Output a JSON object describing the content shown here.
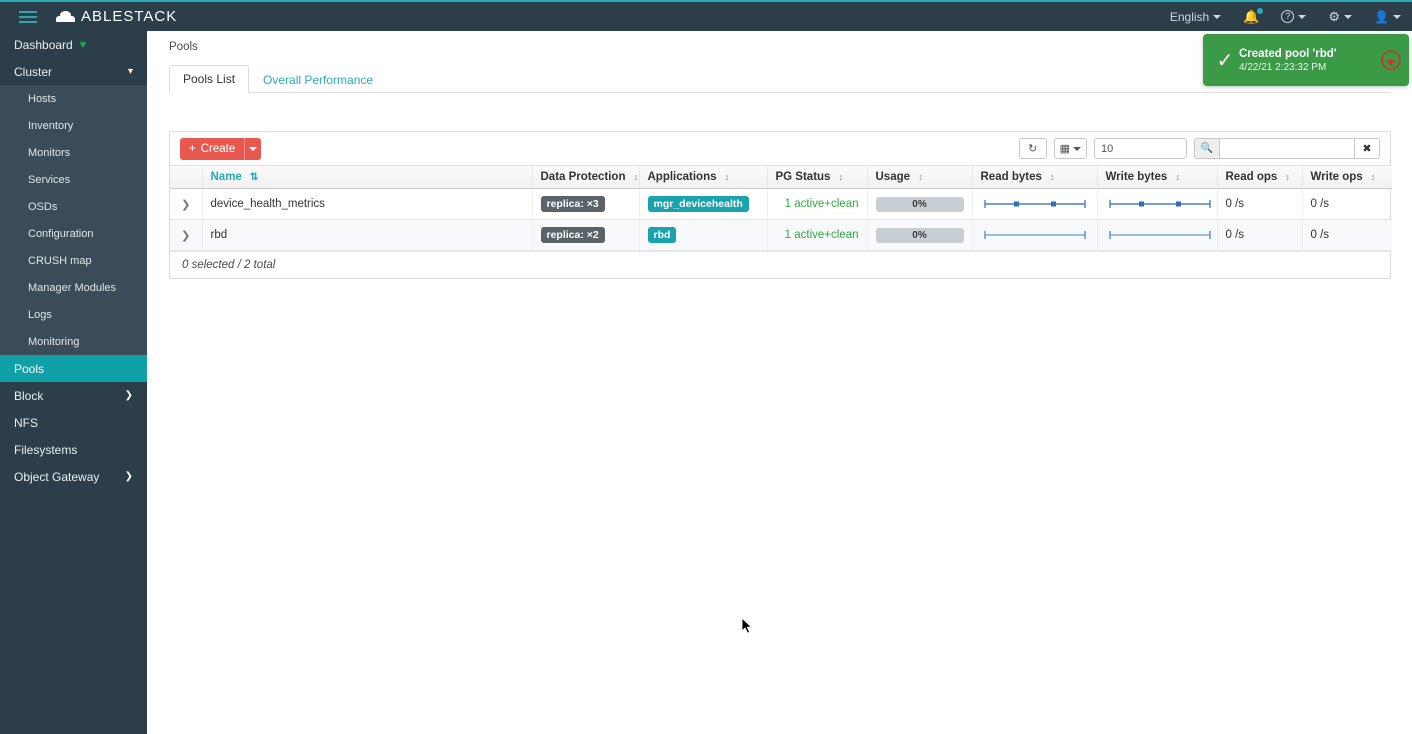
{
  "topbar": {
    "brand": "ABLESTACK",
    "menu_icon": "hamburger-icon",
    "language": "English",
    "items": [
      {
        "name": "notifications",
        "icon": "bell-icon"
      },
      {
        "name": "help",
        "icon": "question-circle-icon"
      },
      {
        "name": "settings",
        "icon": "gear-icon"
      },
      {
        "name": "user",
        "icon": "user-icon"
      }
    ]
  },
  "sidebar": {
    "items": [
      {
        "label": "Dashboard",
        "badge": "heart",
        "level": 0,
        "expandable": false,
        "active": false
      },
      {
        "label": "Cluster",
        "level": 0,
        "expandable": true,
        "expanded": true,
        "active": false
      },
      {
        "label": "Hosts",
        "level": 1,
        "active": false
      },
      {
        "label": "Inventory",
        "level": 1,
        "active": false
      },
      {
        "label": "Monitors",
        "level": 1,
        "active": false
      },
      {
        "label": "Services",
        "level": 1,
        "active": false
      },
      {
        "label": "OSDs",
        "level": 1,
        "active": false
      },
      {
        "label": "Configuration",
        "level": 1,
        "active": false
      },
      {
        "label": "CRUSH map",
        "level": 1,
        "active": false
      },
      {
        "label": "Manager Modules",
        "level": 1,
        "active": false
      },
      {
        "label": "Logs",
        "level": 1,
        "active": false
      },
      {
        "label": "Monitoring",
        "level": 1,
        "active": false
      },
      {
        "label": "Pools",
        "level": 0,
        "expandable": false,
        "active": true
      },
      {
        "label": "Block",
        "level": 0,
        "expandable": true,
        "expanded": false,
        "active": false
      },
      {
        "label": "NFS",
        "level": 0,
        "expandable": false,
        "active": false
      },
      {
        "label": "Filesystems",
        "level": 0,
        "expandable": false,
        "active": false
      },
      {
        "label": "Object Gateway",
        "level": 0,
        "expandable": true,
        "expanded": false,
        "active": false
      }
    ]
  },
  "breadcrumb": "Pools",
  "tabs": [
    {
      "label": "Pools List",
      "active": true
    },
    {
      "label": "Overall Performance",
      "active": false
    }
  ],
  "toolbar": {
    "create_label": "Create",
    "create_plus": "+",
    "refresh_icon": "refresh-icon",
    "columns_icon": "table-columns-icon",
    "limit_value": "10",
    "limit_placeholder": "10",
    "search_value": "",
    "search_placeholder": "",
    "search_icon": "search-icon",
    "clear_icon": "close-icon"
  },
  "table": {
    "columns": [
      {
        "label": "",
        "key": "expand"
      },
      {
        "label": "Name",
        "key": "name",
        "sorted": true
      },
      {
        "label": "Data Protection",
        "key": "data_protection"
      },
      {
        "label": "Applications",
        "key": "applications"
      },
      {
        "label": "PG Status",
        "key": "pg_status"
      },
      {
        "label": "Usage",
        "key": "usage"
      },
      {
        "label": "Read bytes",
        "key": "read_bytes"
      },
      {
        "label": "Write bytes",
        "key": "write_bytes"
      },
      {
        "label": "Read ops",
        "key": "read_ops"
      },
      {
        "label": "Write ops",
        "key": "write_ops"
      }
    ],
    "rows": [
      {
        "name": "device_health_metrics",
        "data_protection": "replica: ×3",
        "applications": "mgr_devicehealth",
        "pg_status": "1 active+clean",
        "usage": "0%",
        "read_ops": "0 /s",
        "write_ops": "0 /s"
      },
      {
        "name": "rbd",
        "data_protection": "replica: ×2",
        "applications": "rbd",
        "pg_status": "1 active+clean",
        "usage": "0%",
        "read_ops": "0 /s",
        "write_ops": "0 /s"
      }
    ],
    "footer": "0 selected / 2 total"
  },
  "chart_data": [
    {
      "type": "line",
      "title": "Read bytes sparkline - device_health_metrics",
      "x": [
        0,
        1,
        2,
        3,
        4,
        5,
        6,
        7,
        8,
        9
      ],
      "values": [
        0,
        0,
        0,
        0,
        0,
        0,
        0,
        0,
        0,
        0
      ],
      "markers": [
        2,
        5
      ],
      "ylim": [
        0,
        1
      ],
      "grid": false,
      "color": "#4a7fbf"
    },
    {
      "type": "line",
      "title": "Write bytes sparkline - device_health_metrics",
      "x": [
        0,
        1,
        2,
        3,
        4,
        5,
        6,
        7,
        8,
        9
      ],
      "values": [
        0,
        0,
        0,
        0,
        0,
        0,
        0,
        0,
        0,
        0
      ],
      "markers": [
        3,
        6
      ],
      "ylim": [
        0,
        1
      ],
      "grid": false,
      "color": "#4a7fbf"
    },
    {
      "type": "line",
      "title": "Read bytes sparkline - rbd",
      "x": [
        0,
        1,
        2,
        3,
        4,
        5,
        6,
        7,
        8,
        9
      ],
      "values": [
        0,
        0,
        0,
        0,
        0,
        0,
        0,
        0,
        0,
        0
      ],
      "markers": [],
      "ylim": [
        0,
        1
      ],
      "grid": false,
      "color": "#7aa8d8"
    },
    {
      "type": "line",
      "title": "Write bytes sparkline - rbd",
      "x": [
        0,
        1,
        2,
        3,
        4,
        5,
        6,
        7,
        8,
        9
      ],
      "values": [
        0,
        0,
        0,
        0,
        0,
        0,
        0,
        0,
        0,
        0
      ],
      "markers": [],
      "ylim": [
        0,
        1
      ],
      "grid": false,
      "color": "#7aa8d8"
    }
  ],
  "toast": {
    "title": "Created pool 'rbd'",
    "time": "4/22/21 2:23:32 PM",
    "icon": "check-icon",
    "logo": "ceph-logo-icon",
    "color": "#3a9a46"
  },
  "colors": {
    "brand_teal": "#29abb5",
    "sidebar": "#2b3e4a",
    "sidebar_sub": "#3b4c58",
    "active_item": "#10a0a8",
    "create_red": "#e8584f",
    "success_green": "#3a9a46",
    "pg_ok_green": "#2eab3f"
  }
}
